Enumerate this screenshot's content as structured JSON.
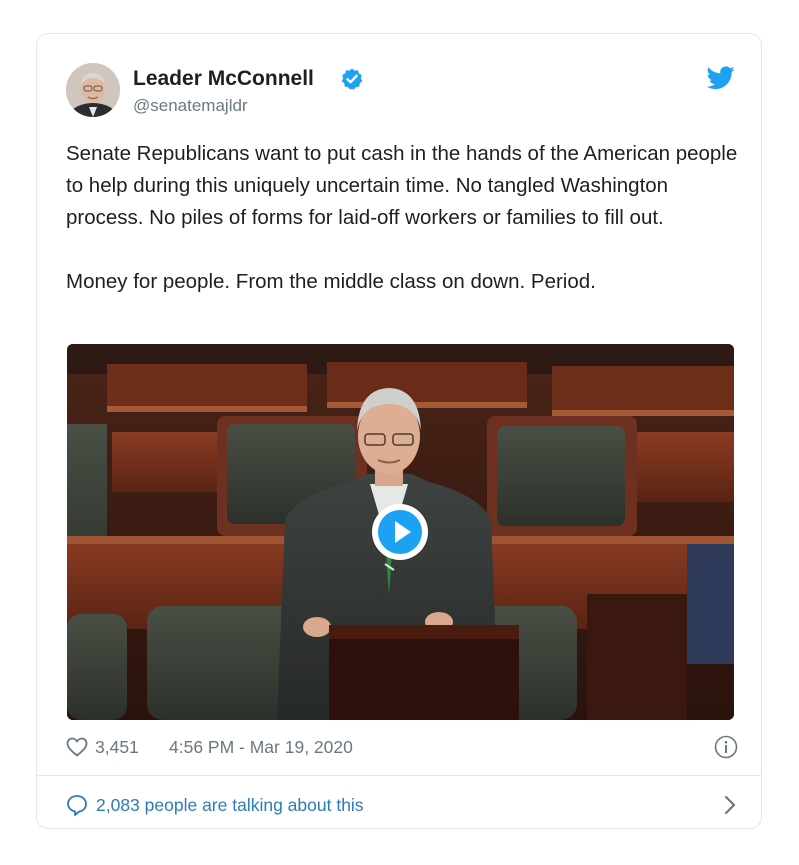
{
  "author": {
    "name": "Leader McConnell",
    "handle": "@senatemajldr"
  },
  "tweet": {
    "paragraphs": [
      "Senate Republicans want to put cash in the hands of the American people to help during this uniquely uncertain time. No tangled Washington process. No piles of forms for laid-off workers or families to fill out.",
      "Money for people. From the middle class on down. Period."
    ]
  },
  "media": {
    "type": "video",
    "play_icon": "play-icon"
  },
  "meta": {
    "like_count": "3,451",
    "timestamp": "4:56 PM - Mar 19, 2020"
  },
  "talking": {
    "label": "2,083 people are talking about this"
  },
  "icons": {
    "verified": "verified-badge-icon",
    "brand": "twitter-bird-icon",
    "like": "heart-icon",
    "info": "info-icon",
    "reply": "speech-bubble-icon",
    "chevron": "chevron-right-icon"
  },
  "colors": {
    "accent": "#1da1f2",
    "link": "#2b7bb9",
    "muted": "#697882",
    "text": "#1c2022",
    "border": "#e1e8ed"
  }
}
